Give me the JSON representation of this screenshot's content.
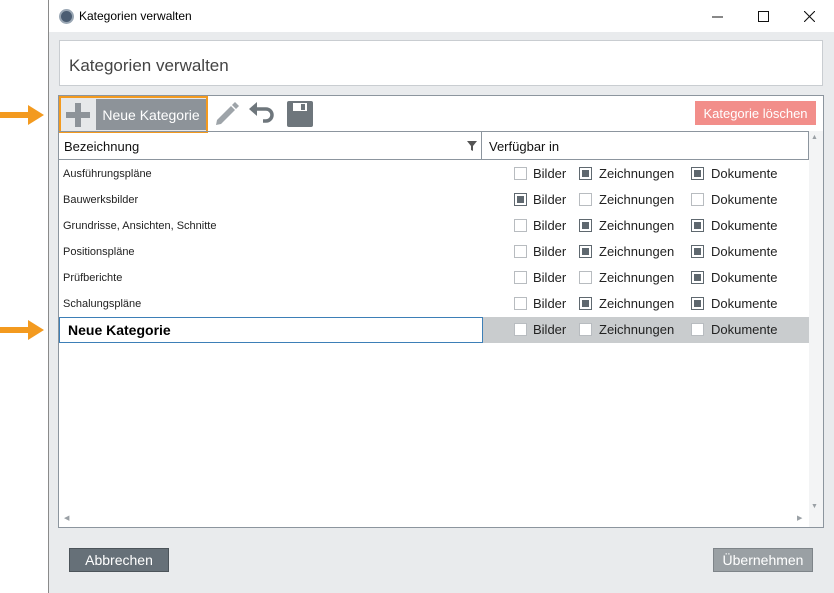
{
  "window": {
    "title": "Kategorien verwalten",
    "minimize_glyph": "—",
    "maximize_glyph": "☐",
    "close_glyph": "✕"
  },
  "header": {
    "title": "Kategorien verwalten"
  },
  "toolbar": {
    "new_category_label": "Neue Kategorie",
    "delete_category_label": "Kategorie löschen",
    "icons": [
      "plus-icon",
      "pencil-icon",
      "undo-icon",
      "save-icon"
    ]
  },
  "grid": {
    "columns": {
      "name": "Bezeichnung",
      "available": "Verfügbar in"
    },
    "option_labels": {
      "images": "Bilder",
      "drawings": "Zeichnungen",
      "documents": "Dokumente"
    },
    "rows": [
      {
        "name": "Ausführungspläne",
        "images": false,
        "drawings": true,
        "documents": true
      },
      {
        "name": "Bauwerksbilder",
        "images": true,
        "drawings": false,
        "documents": false
      },
      {
        "name": "Grundrisse, Ansichten, Schnitte",
        "images": false,
        "drawings": true,
        "documents": true
      },
      {
        "name": "Positionspläne",
        "images": false,
        "drawings": true,
        "documents": true
      },
      {
        "name": "Prüfberichte",
        "images": false,
        "drawings": false,
        "documents": true
      },
      {
        "name": "Schalungspläne",
        "images": false,
        "drawings": true,
        "documents": true
      }
    ],
    "editing_row": {
      "value": "Neue Kategorie",
      "images": false,
      "drawings": false,
      "documents": false
    }
  },
  "footer": {
    "cancel_label": "Abbrechen",
    "apply_label": "Übernehmen"
  },
  "colors": {
    "accent_orange": "#f39a1f",
    "delete_red": "#f28e8a",
    "checkbox_checked": "#5f686f"
  }
}
